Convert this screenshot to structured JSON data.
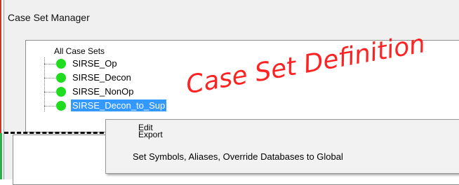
{
  "window": {
    "title": "Case Set Manager"
  },
  "tree": {
    "root": "All Case Sets",
    "items": [
      {
        "label": "SIRSE_Op",
        "status_color": "#1fdc1f"
      },
      {
        "label": "SIRSE_Decon",
        "status_color": "#1fdc1f"
      },
      {
        "label": "SIRSE_NonOp",
        "status_color": "#1fdc1f"
      },
      {
        "label": "SIRSE_Decon_to_Sup",
        "status_color": "#1fdc1f",
        "selected": true
      }
    ]
  },
  "overlay_text": "Case Set Definition",
  "context_menu": {
    "items": [
      "Edit",
      "Export",
      "Set Symbols, Aliases, Override Databases to Global"
    ]
  }
}
